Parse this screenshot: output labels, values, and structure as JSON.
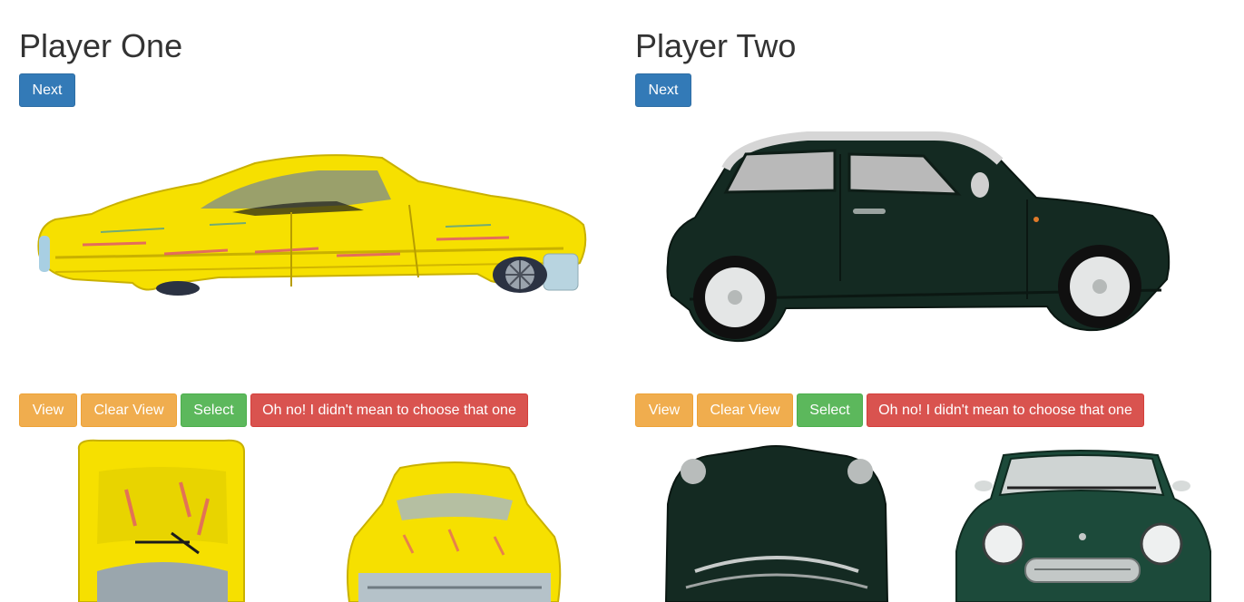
{
  "players": [
    {
      "title": "Player One",
      "next_label": "Next",
      "main_image": "yellow-classic-car-side-view",
      "thumbnails": [
        "yellow-car-top-view",
        "yellow-car-front-view"
      ],
      "buttons": {
        "view": "View",
        "clear_view": "Clear View",
        "select": "Select",
        "undo": "Oh no! I didn't mean to choose that one"
      }
    },
    {
      "title": "Player Two",
      "next_label": "Next",
      "main_image": "green-mini-car-side-view",
      "thumbnails": [
        "green-mini-top-view",
        "green-mini-front-view"
      ],
      "buttons": {
        "view": "View",
        "clear_view": "Clear View",
        "select": "Select",
        "undo": "Oh no! I didn't mean to choose that one"
      }
    }
  ],
  "colors": {
    "primary": "#337ab7",
    "warning": "#f0ad4e",
    "success": "#5cb85c",
    "danger": "#d9534f"
  }
}
